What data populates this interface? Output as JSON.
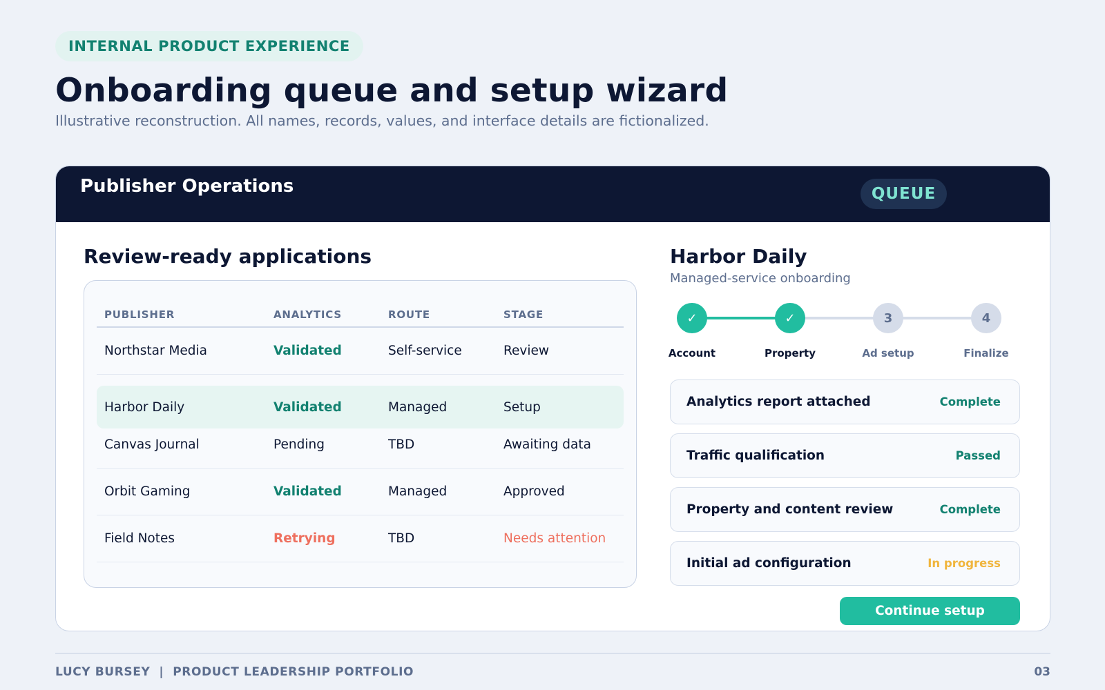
{
  "eyebrow": "INTERNAL PRODUCT EXPERIENCE",
  "title": "Onboarding queue and setup wizard",
  "subtitle": "Illustrative reconstruction. All names, records, values, and interface details are fictionalized.",
  "card": {
    "header_title": "Publisher Operations",
    "header_badge": "QUEUE"
  },
  "table": {
    "title": "Review-ready applications",
    "columns": [
      "PUBLISHER",
      "ANALYTICS",
      "ROUTE",
      "STAGE"
    ],
    "rows": [
      {
        "publisher": "Northstar Media",
        "analytics": "Validated",
        "route": "Self-service",
        "stage": "Review"
      },
      {
        "publisher": "Harbor Daily",
        "analytics": "Validated",
        "route": "Managed",
        "stage": "Setup"
      },
      {
        "publisher": "Canvas Journal",
        "analytics": "Pending",
        "route": "TBD",
        "stage": "Awaiting data"
      },
      {
        "publisher": "Orbit Gaming",
        "analytics": "Validated",
        "route": "Managed",
        "stage": "Approved"
      },
      {
        "publisher": "Field Notes",
        "analytics": "Retrying",
        "route": "TBD",
        "stage": "Needs attention"
      }
    ],
    "selected_row": 1
  },
  "detail": {
    "title": "Harbor Daily",
    "subtitle": "Managed-service onboarding",
    "steps": [
      {
        "marker": "✓",
        "label": "Account",
        "done": true
      },
      {
        "marker": "✓",
        "label": "Property",
        "done": true
      },
      {
        "marker": "3",
        "label": "Ad setup",
        "done": false
      },
      {
        "marker": "4",
        "label": "Finalize",
        "done": false
      }
    ],
    "checks": [
      {
        "label": "Analytics report attached",
        "status": "Complete",
        "status_type": "ok"
      },
      {
        "label": "Traffic qualification",
        "status": "Passed",
        "status_type": "ok"
      },
      {
        "label": "Property and content review",
        "status": "Complete",
        "status_type": "ok"
      },
      {
        "label": "Initial ad configuration",
        "status": "In progress",
        "status_type": "progress"
      }
    ],
    "continue_label": "Continue setup"
  },
  "footer": {
    "left": "LUCY BURSEY  |  PRODUCT LEADERSHIP PORTFOLIO",
    "page": "03"
  },
  "colors": {
    "accent": "#21bda0",
    "accent_text": "#128170",
    "navy": "#0d1733",
    "warning": "#ee6f5e",
    "in_progress": "#f0b53d"
  }
}
